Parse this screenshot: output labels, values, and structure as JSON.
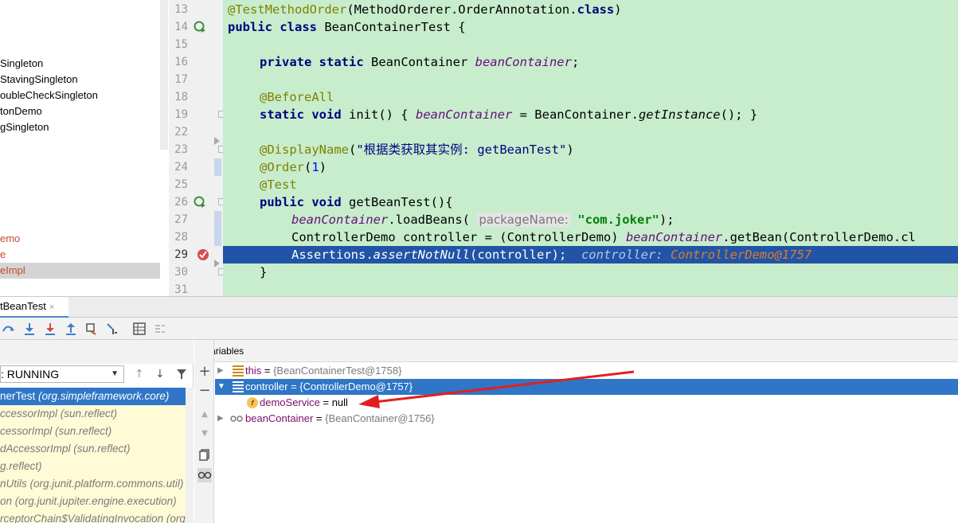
{
  "tree": {
    "items": [
      {
        "label": "Singleton",
        "style": "normal"
      },
      {
        "label": "StavingSingleton",
        "style": "normal"
      },
      {
        "label": "oubleCheckSingleton",
        "style": "normal"
      },
      {
        "label": "tonDemo",
        "style": "normal"
      },
      {
        "label": "gSingleton",
        "style": "normal"
      },
      {
        "label": "emo",
        "style": "error"
      },
      {
        "label": "e",
        "style": "error"
      },
      {
        "label": "eImpl",
        "style": "error-selected"
      }
    ]
  },
  "editor": {
    "line_numbers": [
      "13",
      "14",
      "15",
      "16",
      "17",
      "18",
      "19",
      "22",
      "23",
      "24",
      "25",
      "26",
      "27",
      "28",
      "29",
      "30",
      "31"
    ],
    "lines": {
      "l13_ann": "@TestMethodOrder",
      "l13_rest": "(MethodOrderer.OrderAnnotation.",
      "l13_kw": "class",
      "l13_end": ")",
      "l14_kw": "public class",
      "l14_rest": " BeanContainerTest {",
      "l16_kw": "private static",
      "l16_type": " BeanContainer ",
      "l16_fld": "beanContainer",
      "l16_end": ";",
      "l18_ann": "@BeforeAll",
      "l19_kw": "static void",
      "l19_rest": " init() { ",
      "l19_fld": "beanContainer",
      "l19_mid": " = BeanContainer.",
      "l19_it": "getInstance",
      "l19_end": "(); }",
      "l23_ann": "@DisplayName",
      "l23_open": "(",
      "l23_str": "\"根据类获取其实例: getBeanTest\"",
      "l23_end": ")",
      "l24_ann": "@Order",
      "l24_open": "(",
      "l24_num": "1",
      "l24_end": ")",
      "l25_ann": "@Test",
      "l26_kw": "public void",
      "l26_rest": " getBeanTest(){",
      "l27_fld": "beanContainer",
      "l27_mid": ".loadBeans( ",
      "l27_hint": "packageName:",
      "l27_str": " \"com.joker\"",
      "l27_end": ");",
      "l28_a": "ControllerDemo controller = (ControllerDemo) ",
      "l28_fld": "beanContainer",
      "l28_b": ".getBean(ControllerDemo.cl",
      "l29_a": "Assertions.",
      "l29_it": "assertNotNull",
      "l29_b": "(controller);  ",
      "l29_dbg_name": "controller: ",
      "l29_dbg_val": "ControllerDemo@1757",
      "l30": "}"
    }
  },
  "debug": {
    "tab_label": "tBeanTest",
    "tab_close": "×",
    "vars_title": "Variables",
    "thread": "RUNNING",
    "thread_prefix": ": ",
    "frames": [
      {
        "name": "nerTest ",
        "pkg": "(org.simpleframework.core)",
        "selected": true
      },
      {
        "name": "ccessorImpl ",
        "pkg": "(sun.reflect)",
        "selected": false
      },
      {
        "name": "cessorImpl ",
        "pkg": "(sun.reflect)",
        "selected": false
      },
      {
        "name": "dAccessorImpl ",
        "pkg": "(sun.reflect)",
        "selected": false
      },
      {
        "name": "g.reflect)",
        "pkg": "",
        "selected": false
      },
      {
        "name": "nUtils ",
        "pkg": "(org.junit.platform.commons.util)",
        "selected": false
      },
      {
        "name": "on ",
        "pkg": "(org.junit.jupiter.engine.execution)",
        "selected": false
      },
      {
        "name": "rceptorChain$ValidatingInvocation ",
        "pkg": "(org.",
        "selected": false
      }
    ],
    "variables": [
      {
        "name": "this",
        "eq": " = ",
        "value": "{BeanContainerTest@1758}",
        "indent": 0,
        "expander": "▶",
        "icon": "list",
        "selected": false
      },
      {
        "name": "controller",
        "eq": " = ",
        "value": "{ControllerDemo@1757}",
        "indent": 0,
        "expander": "▼",
        "icon": "list",
        "selected": true
      },
      {
        "name": "demoService",
        "eq": " = ",
        "value": "null",
        "indent": 1,
        "expander": "",
        "icon": "field",
        "selected": false
      },
      {
        "name": "beanContainer",
        "eq": " = ",
        "value": "{BeanContainer@1756}",
        "indent": 0,
        "expander": "▶",
        "icon": "watch",
        "selected": false
      }
    ],
    "field_icon_letter": "f",
    "colors": {
      "selection": "#2f76c7",
      "arrow": "#e02020",
      "editor_bg": "#c7edcc",
      "exec_line": "#2154a6"
    }
  }
}
